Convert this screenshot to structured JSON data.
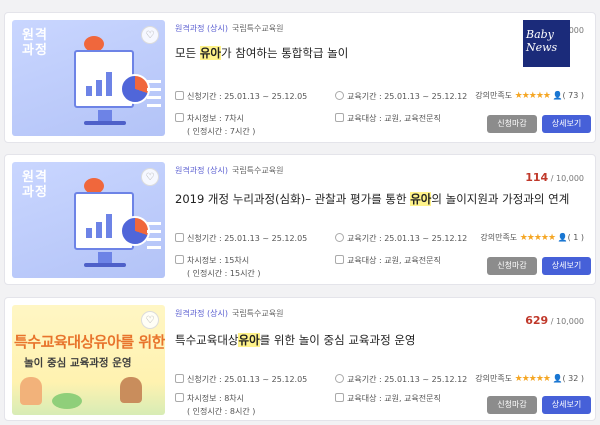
{
  "brand": {
    "logo_line1": "Baby",
    "logo_line2": "News"
  },
  "courses": [
    {
      "thumb_label": [
        "원격",
        "과정"
      ],
      "kind": "원격과정 (상시)",
      "org": "국립특수교육원",
      "enroll_count": "",
      "enroll_total": "000",
      "title_before": "모든 ",
      "title_highlight": "유아",
      "title_after": "가 참여하는 통합학급 놀이",
      "apply_period": "신청기간 : 25.01.13 ~ 25.12.05",
      "edu_period": "교육기간 : 25.01.13 ~ 25.12.12",
      "rating_label": "강의만족도",
      "stars": 4.5,
      "rating_count": "( 73 )",
      "session": "차시정보 : 7차시",
      "recognized": "( 인정시간 : 7시간 )",
      "target": "교육대상 : 교원, 교육전문직",
      "btn_closed": "신청마감",
      "btn_detail": "상세보기"
    },
    {
      "thumb_label": [
        "원격",
        "과정"
      ],
      "kind": "원격과정 (상시)",
      "org": "국립특수교육원",
      "enroll_count": "114",
      "enroll_total": " / 10,000",
      "title_before": "2019 개정 누리과정(심화)– 관찰과 평가를 통한 ",
      "title_highlight": "유아",
      "title_after": "의 놀이지원과 가정과의 연계",
      "apply_period": "신청기간 : 25.01.13 ~ 25.12.05",
      "edu_period": "교육기간 : 25.01.13 ~ 25.12.12",
      "rating_label": "강의만족도",
      "stars": 5,
      "rating_count": "( 1 )",
      "session": "차시정보 : 15차시",
      "recognized": "( 인정시간 : 15시간 )",
      "target": "교육대상 : 교원, 교육전문직",
      "btn_closed": "신청마감",
      "btn_detail": "상세보기"
    },
    {
      "promo_line1": "특수교육대상유아를 위한",
      "promo_line2": "놀이 중심 교육과정 운영",
      "kind": "원격과정 (상시)",
      "org": "국립특수교육원",
      "enroll_count": "629",
      "enroll_total": " / 10,000",
      "title_before": "특수교육대상",
      "title_highlight": "유아",
      "title_after": "를 위한 놀이 중심 교육과정 운영",
      "apply_period": "신청기간 : 25.01.13 ~ 25.12.05",
      "edu_period": "교육기간 : 25.01.13 ~ 25.12.12",
      "rating_label": "강의만족도",
      "stars": 4.5,
      "rating_count": "( 32 )",
      "session": "차시정보 : 8차시",
      "recognized": "( 인정시간 : 8시간 )",
      "target": "교육대상 : 교원, 교육전문직",
      "btn_closed": "신청마감",
      "btn_detail": "상세보기"
    }
  ],
  "icons": {
    "heart": "heart-icon",
    "calendar": "calendar-icon",
    "clock": "clock-icon",
    "list": "list-icon",
    "document": "document-icon",
    "user": "user-icon",
    "star": "star-icon"
  },
  "colors": {
    "accent": "#4660d8",
    "closed": "#8c8c8c",
    "count": "#c0392b",
    "kind": "#5a5ed1",
    "highlight": "#fff38a"
  }
}
